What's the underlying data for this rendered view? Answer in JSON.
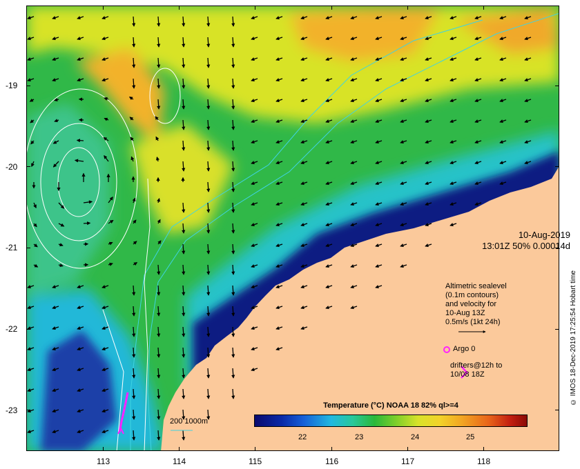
{
  "map": {
    "y_labels": [
      "-19",
      "-20",
      "-21",
      "-22",
      "-23"
    ],
    "x_labels": [
      "113",
      "114",
      "115",
      "116",
      "117",
      "118"
    ],
    "date_line1": "10-Aug-2019",
    "date_line2": "13:01Z  50% 0.00014d",
    "legend_sealevel": [
      "Altimetric sealevel",
      "(0.1m contours)",
      "and velocity for",
      "10-Aug 13Z",
      "0.5m/s (1kt 24h)"
    ],
    "legend_argo": "Argo 0",
    "legend_drifters": [
      "drifters@12h to",
      "10/08 18Z"
    ],
    "isobath_label": "200  1000m",
    "credit": "© IMOS 18-Dec-2019 17:25:54 Hobart time",
    "colorbar_title": "Temperature (°C) NOAA 18 82% ql>=4",
    "colorbar_ticks": [
      "22",
      "23",
      "24",
      "25"
    ],
    "colors": {
      "land": "#fbc99b",
      "cold": "#0a1a7a",
      "cyan": "#25c4d7",
      "green": "#28b83a",
      "yellow": "#e8e62a",
      "orange": "#f5a623",
      "argo": "#ff22ff",
      "isobath": "#3fd3e2"
    }
  }
}
